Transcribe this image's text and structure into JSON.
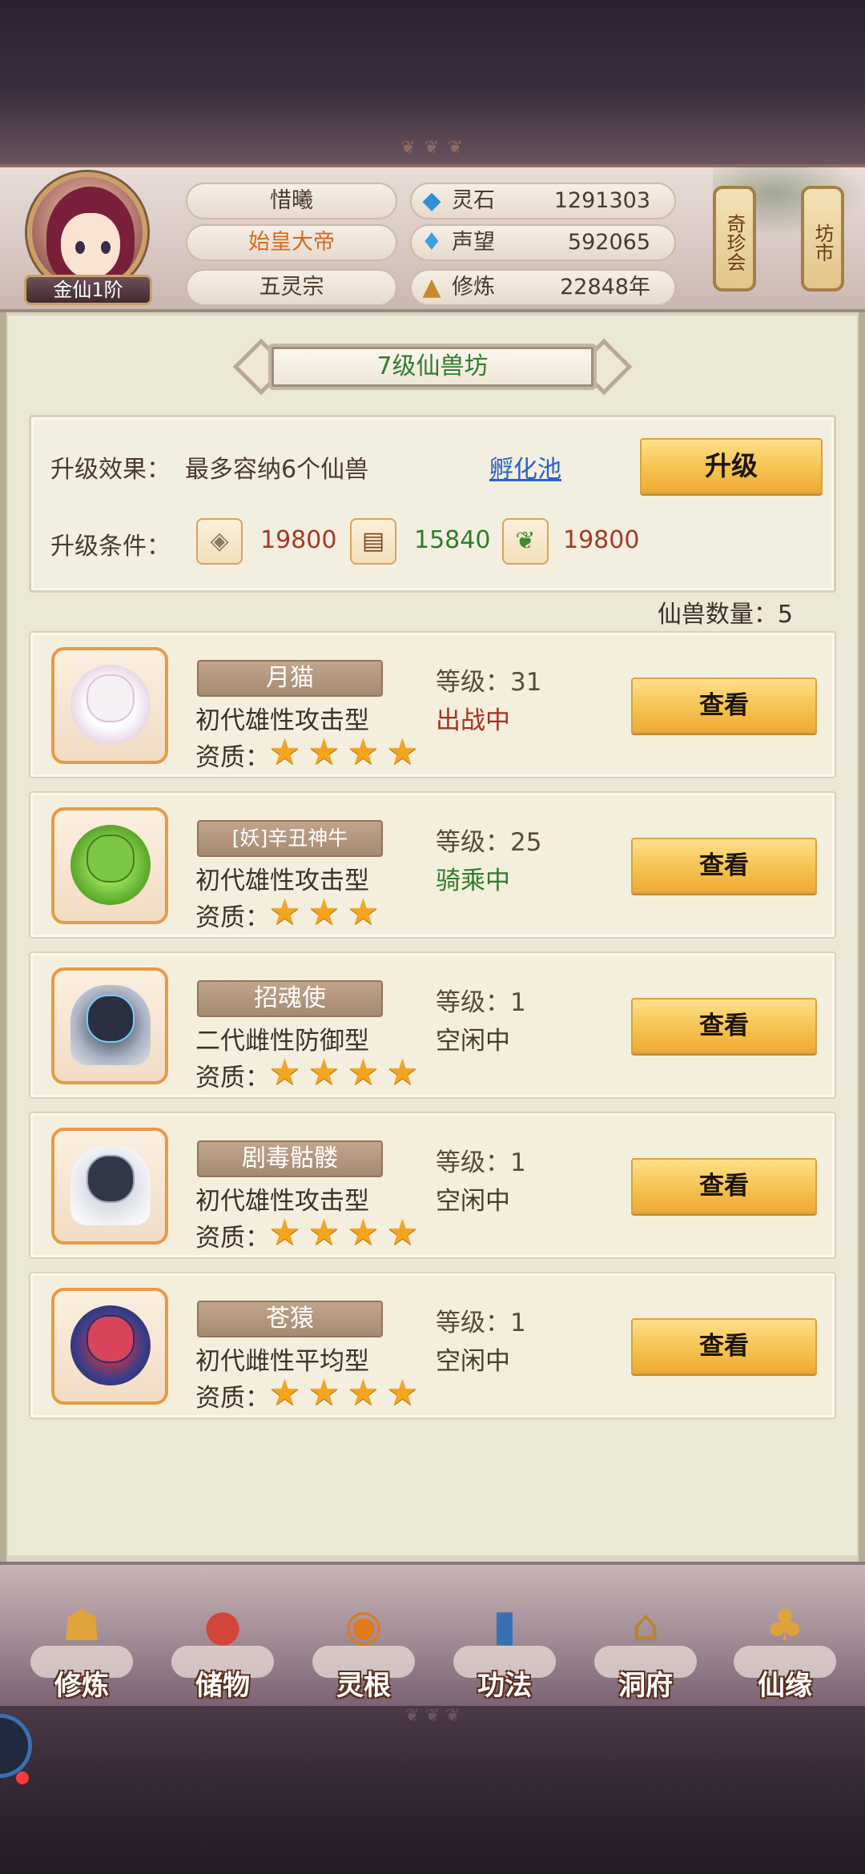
{
  "player": {
    "rank": "金仙1阶",
    "name": "惜曦",
    "title": "始皇大帝",
    "sect": "五灵宗"
  },
  "resources": [
    {
      "icon": "spirit-stone-icon",
      "name": "灵石",
      "value": "1291303"
    },
    {
      "icon": "reputation-icon",
      "name": "声望",
      "value": "592065"
    },
    {
      "icon": "cultivation-icon",
      "name": "修炼",
      "value": "22848年"
    }
  ],
  "side_buttons": {
    "treasure": "奇珍会",
    "market": "坊市"
  },
  "page_title": "7级仙兽坊",
  "upgrade": {
    "effect_label": "升级效果：",
    "effect_value": "最多容纳6个仙兽",
    "hatch_link": "孵化池",
    "button": "升级",
    "cond_label": "升级条件：",
    "materials": [
      {
        "icon": "ore-icon",
        "amount": "19800",
        "color": "#a33a26"
      },
      {
        "icon": "wood-icon",
        "amount": "15840",
        "color": "#2f7d2c"
      },
      {
        "icon": "herb-icon",
        "amount": "19800",
        "color": "#a33a26"
      }
    ]
  },
  "beast_count": "仙兽数量：5",
  "quality_label": "资质：",
  "view_label": "查看",
  "beasts": [
    {
      "name": "月猫",
      "type": "初代雄性攻击型",
      "level": "等级：31",
      "status": "出战中",
      "status_color": "#a8321e",
      "stars": 4,
      "art": "white-cat"
    },
    {
      "name": "[妖]辛丑神牛",
      "type": "初代雄性攻击型",
      "level": "等级：25",
      "status": "骑乘中",
      "status_color": "#2f7d2c",
      "stars": 3,
      "art": "green-ox"
    },
    {
      "name": "招魂使",
      "type": "二代雌性防御型",
      "level": "等级：1",
      "status": "空闲中",
      "status_color": "#4a3a2e",
      "stars": 4,
      "art": "hooded-spirit"
    },
    {
      "name": "剧毒骷髅",
      "type": "初代雄性攻击型",
      "level": "等级：1",
      "status": "空闲中",
      "status_color": "#4a3a2e",
      "stars": 4,
      "art": "hooded-skeleton"
    },
    {
      "name": "苍猿",
      "type": "初代雌性平均型",
      "level": "等级：1",
      "status": "空闲中",
      "status_color": "#4a3a2e",
      "stars": 4,
      "art": "dragon-ape"
    }
  ],
  "nav": [
    {
      "label": "修炼",
      "icon": "meditation-icon"
    },
    {
      "label": "储物",
      "icon": "storage-bag-icon"
    },
    {
      "label": "灵根",
      "icon": "spirit-root-icon"
    },
    {
      "label": "功法",
      "icon": "scripture-book-icon"
    },
    {
      "label": "洞府",
      "icon": "cave-mansion-icon"
    },
    {
      "label": "仙缘",
      "icon": "gourd-icon"
    }
  ]
}
